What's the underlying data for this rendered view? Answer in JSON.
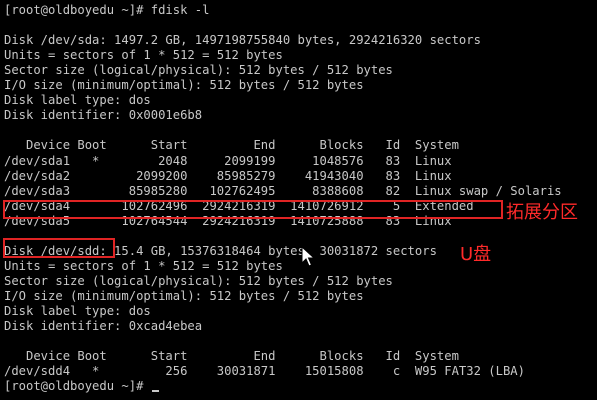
{
  "terminal": {
    "lines": [
      "[root@oldboyedu ~]# fdisk -l",
      "",
      "Disk /dev/sda: 1497.2 GB, 1497198755840 bytes, 2924216320 sectors",
      "Units = sectors of 1 * 512 = 512 bytes",
      "Sector size (logical/physical): 512 bytes / 512 bytes",
      "I/O size (minimum/optimal): 512 bytes / 512 bytes",
      "Disk label type: dos",
      "Disk identifier: 0x0001e6b8",
      "",
      "   Device Boot      Start         End      Blocks   Id  System",
      "/dev/sda1   *        2048     2099199     1048576   83  Linux",
      "/dev/sda2         2099200    85985279    41943040   83  Linux",
      "/dev/sda3        85985280   102762495     8388608   82  Linux swap / Solaris",
      "/dev/sda4       102762496  2924216319  1410726912    5  Extended",
      "/dev/sda5       102764544  2924216319  1410725888   83  Linux",
      "",
      "Disk /dev/sdd: 15.4 GB, 15376318464 bytes, 30031872 sectors",
      "Units = sectors of 1 * 512 = 512 bytes",
      "Sector size (logical/physical): 512 bytes / 512 bytes",
      "I/O size (minimum/optimal): 512 bytes / 512 bytes",
      "Disk label type: dos",
      "Disk identifier: 0xcad4ebea",
      "",
      "   Device Boot      Start         End      Blocks   Id  System",
      "/dev/sdd4   *         256    30031871    15015808    c  W95 FAT32 (LBA)",
      "[root@oldboyedu ~]# "
    ]
  },
  "annotations": {
    "extended_label": "拓展分区",
    "usb_label": "U盘"
  },
  "colors": {
    "terminal_bg": "#000000",
    "terminal_fg": "#c8c8c8",
    "annotation": "#e02424"
  }
}
